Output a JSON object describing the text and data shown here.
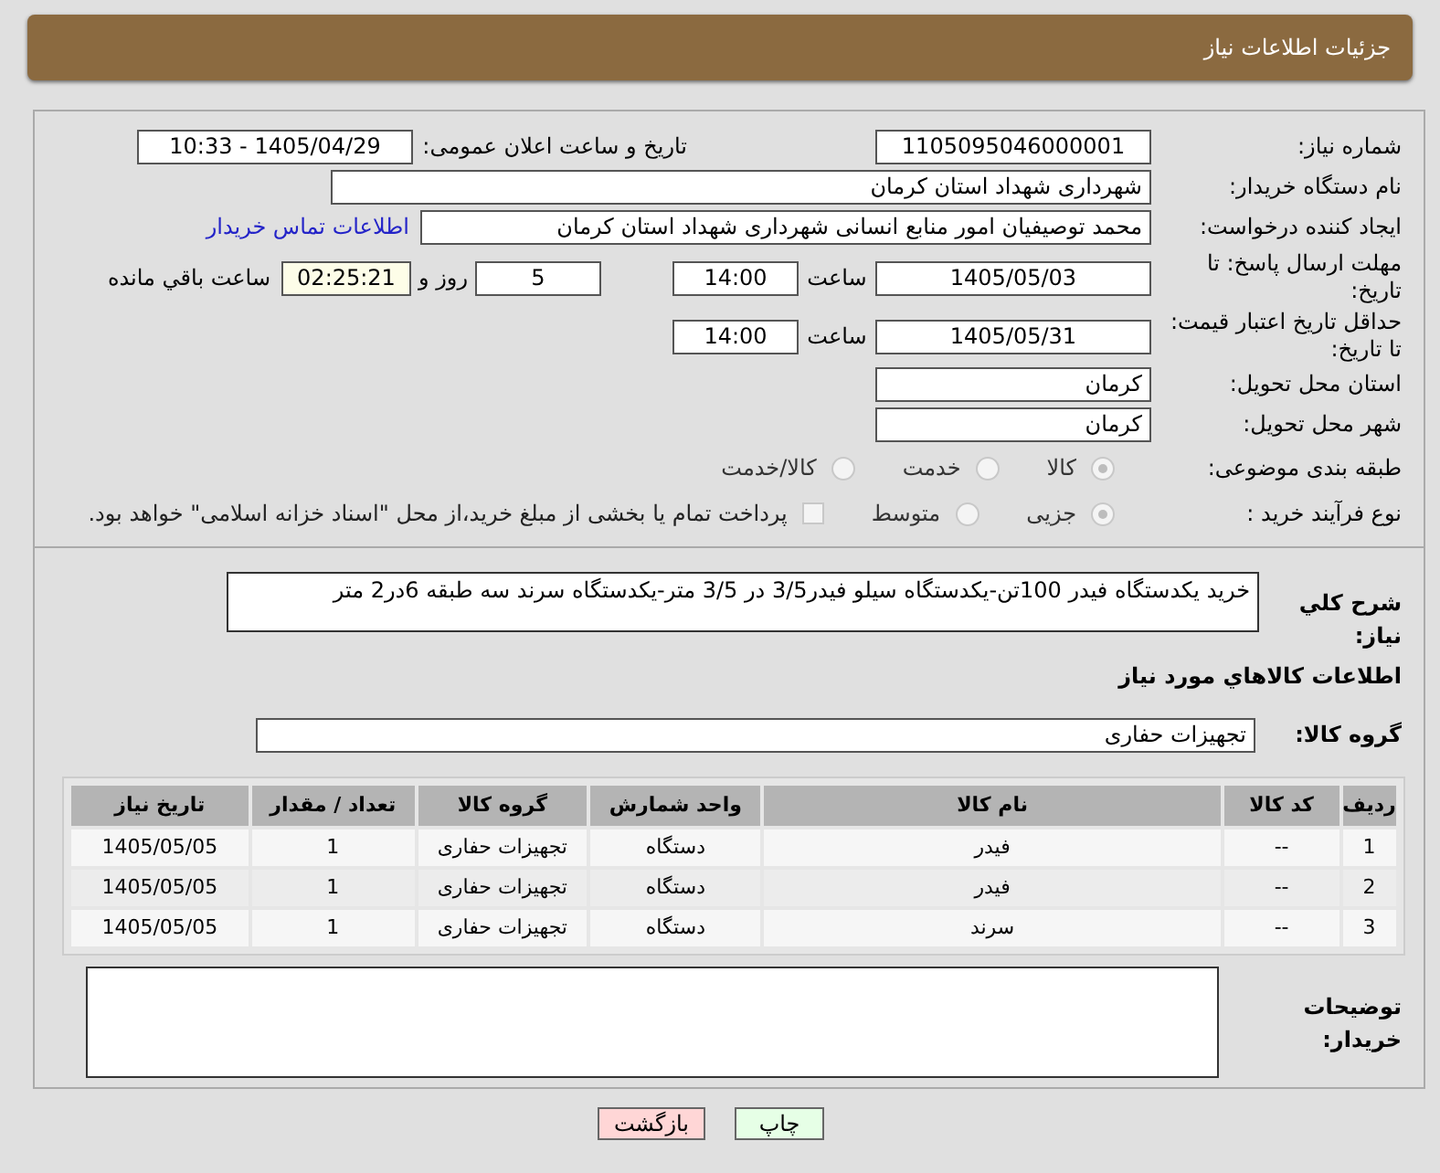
{
  "header": {
    "title": "جزئیات اطلاعات نیاز"
  },
  "need_number": {
    "label": "شماره نیاز:",
    "value": "1105095046000001"
  },
  "announce": {
    "label": "تاریخ و ساعت اعلان عمومی:",
    "value": "1405/04/29 - 10:33"
  },
  "buyer_org": {
    "label": "نام دستگاه خریدار:",
    "value": "شهرداری شهداد استان کرمان"
  },
  "requester": {
    "label": "ایجاد کننده درخواست:",
    "value": "محمد توصیفیان امور منابع انسانی شهرداری شهداد استان کرمان",
    "link": "اطلاعات تماس خریدار"
  },
  "deadline": {
    "label": "مهلت ارسال پاسخ: تا تاریخ:",
    "date": "1405/05/03",
    "time_label": "ساعت",
    "time": "14:00",
    "days": "5",
    "days_label": "روز و",
    "remaining": "02:25:21",
    "remaining_label": "ساعت باقي مانده"
  },
  "price_validity": {
    "label": "حداقل تاریخ اعتبار قیمت: تا تاریخ:",
    "date": "1405/05/31",
    "time_label": "ساعت",
    "time": "14:00"
  },
  "delivery_province": {
    "label": "استان محل تحویل:",
    "value": "کرمان"
  },
  "delivery_city": {
    "label": "شهر محل تحویل:",
    "value": "کرمان"
  },
  "category": {
    "label": "طبقه بندی موضوعی:",
    "options": [
      {
        "label": "کالا",
        "selected": true
      },
      {
        "label": "خدمت",
        "selected": false
      },
      {
        "label": "کالا/خدمت",
        "selected": false
      }
    ]
  },
  "process": {
    "label": "نوع فرآیند خرید :",
    "options": [
      {
        "label": "جزیی",
        "selected": true
      },
      {
        "label": "متوسط",
        "selected": false
      }
    ],
    "treasury": {
      "checked": false,
      "label": "پرداخت تمام یا بخشی از مبلغ خرید،از محل \"اسناد خزانه اسلامی\" خواهد بود."
    }
  },
  "description": {
    "label": "شرح كلي نياز:",
    "value": "خرید یکدستگاه فیدر 100تن-یکدستگاه سیلو فیدر3/5 در 3/5 متر-یکدستگاه سرند سه طبقه 6در2 متر"
  },
  "goods_title": "اطلاعات كالاهاي مورد نياز",
  "goods_group": {
    "label": "گروه كالا:",
    "value": "تجهیزات حفاری"
  },
  "table": {
    "columns": [
      "رديف",
      "کد کالا",
      "نام کالا",
      "واحد شمارش",
      "گروه کالا",
      "تعداد / مقدار",
      "تاریخ نیاز"
    ],
    "rows": [
      [
        "1",
        "--",
        "فیدر",
        "دستگاه",
        "تجهیزات حفاری",
        "1",
        "1405/05/05"
      ],
      [
        "2",
        "--",
        "فیدر",
        "دستگاه",
        "تجهیزات حفاری",
        "1",
        "1405/05/05"
      ],
      [
        "3",
        "--",
        "سرند",
        "دستگاه",
        "تجهیزات حفاری",
        "1",
        "1405/05/05"
      ]
    ]
  },
  "buyer_notes": {
    "label": "توضیحات خریدار:"
  },
  "buttons": [
    {
      "kind": "print",
      "label": "چاپ"
    },
    {
      "kind": "back",
      "label": "بازگشت"
    }
  ]
}
